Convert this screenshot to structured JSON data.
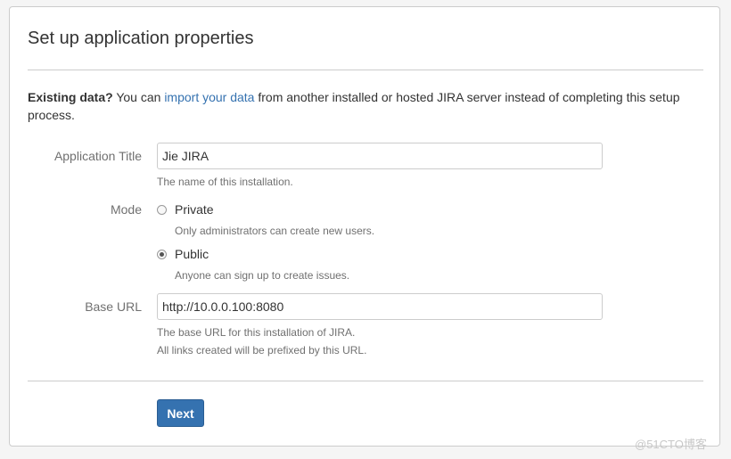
{
  "page": {
    "title": "Set up application properties"
  },
  "intro": {
    "bold": "Existing data?",
    "before_link": " You can ",
    "link": "import your data",
    "after_link": " from another installed or hosted JIRA server instead of completing this setup process."
  },
  "fields": {
    "app_title": {
      "label": "Application Title",
      "value": "Jie JIRA",
      "description": "The name of this installation."
    },
    "mode": {
      "label": "Mode",
      "options": [
        {
          "label": "Private",
          "description": "Only administrators can create new users.",
          "checked": false
        },
        {
          "label": "Public",
          "description": "Anyone can sign up to create issues.",
          "checked": true
        }
      ]
    },
    "base_url": {
      "label": "Base URL",
      "value": "http://10.0.0.100:8080",
      "description_1": "The base URL for this installation of JIRA.",
      "description_2": "All links created will be prefixed by this URL."
    }
  },
  "actions": {
    "next_label": "Next"
  },
  "watermark": "@51CTO博客",
  "colors": {
    "link": "#3572b0",
    "button": "#3572b0"
  }
}
